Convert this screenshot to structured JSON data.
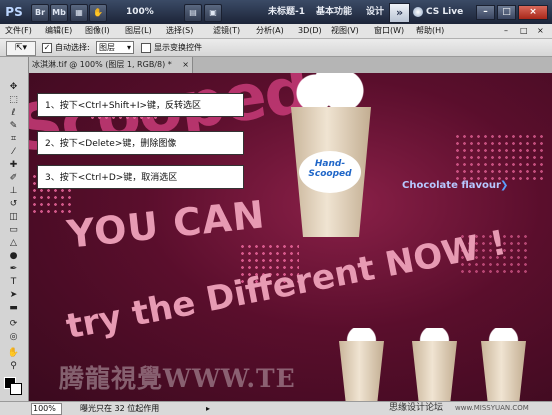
{
  "titlebar": {
    "app_logo": "PS",
    "buttons": [
      "Br",
      "Mb"
    ],
    "zoom": "100%",
    "doc_title": "未标题-1",
    "workspace": "基本功能",
    "design": "设计",
    "more": "»",
    "cs_live": "CS Live",
    "win_buttons": [
      "–",
      "□",
      "×"
    ]
  },
  "menubar": {
    "items": [
      "文件(F)",
      "编辑(E)",
      "图像(I)",
      "图层(L)",
      "选择(S)",
      "滤镜(T)",
      "分析(A)",
      "3D(D)",
      "视图(V)",
      "窗口(W)",
      "帮助(H)"
    ],
    "window_controls": [
      "–",
      "□",
      "×"
    ]
  },
  "options": {
    "auto_select_label": "自动选择:",
    "auto_select_value": "图层",
    "show_transform_label": "显示变换控件"
  },
  "document": {
    "tab_label": "冰淇淋.tif @ 100% (图层 1, RGB/8) *",
    "tab_close": "×"
  },
  "canvas_art": {
    "bg_word": "Scooped",
    "you_can": "YOU CAN",
    "try_line": "try the Different NOW !",
    "brand": "Hand-Scooped",
    "flavour": "Chocolate flavour",
    "watermark": "腾龍視覺WWW.TE"
  },
  "steps": [
    "1、按下<Ctrl+Shift+I>键，反转选区",
    "2、按下<Delete>键，删除图像",
    "3、按下<Ctrl+D>键，取消选区"
  ],
  "statusbar": {
    "zoom": "100%",
    "info": "曝光只在 32 位起作用",
    "forum": "思缘设计论坛",
    "site": "www.MISSYUAN.COM"
  }
}
